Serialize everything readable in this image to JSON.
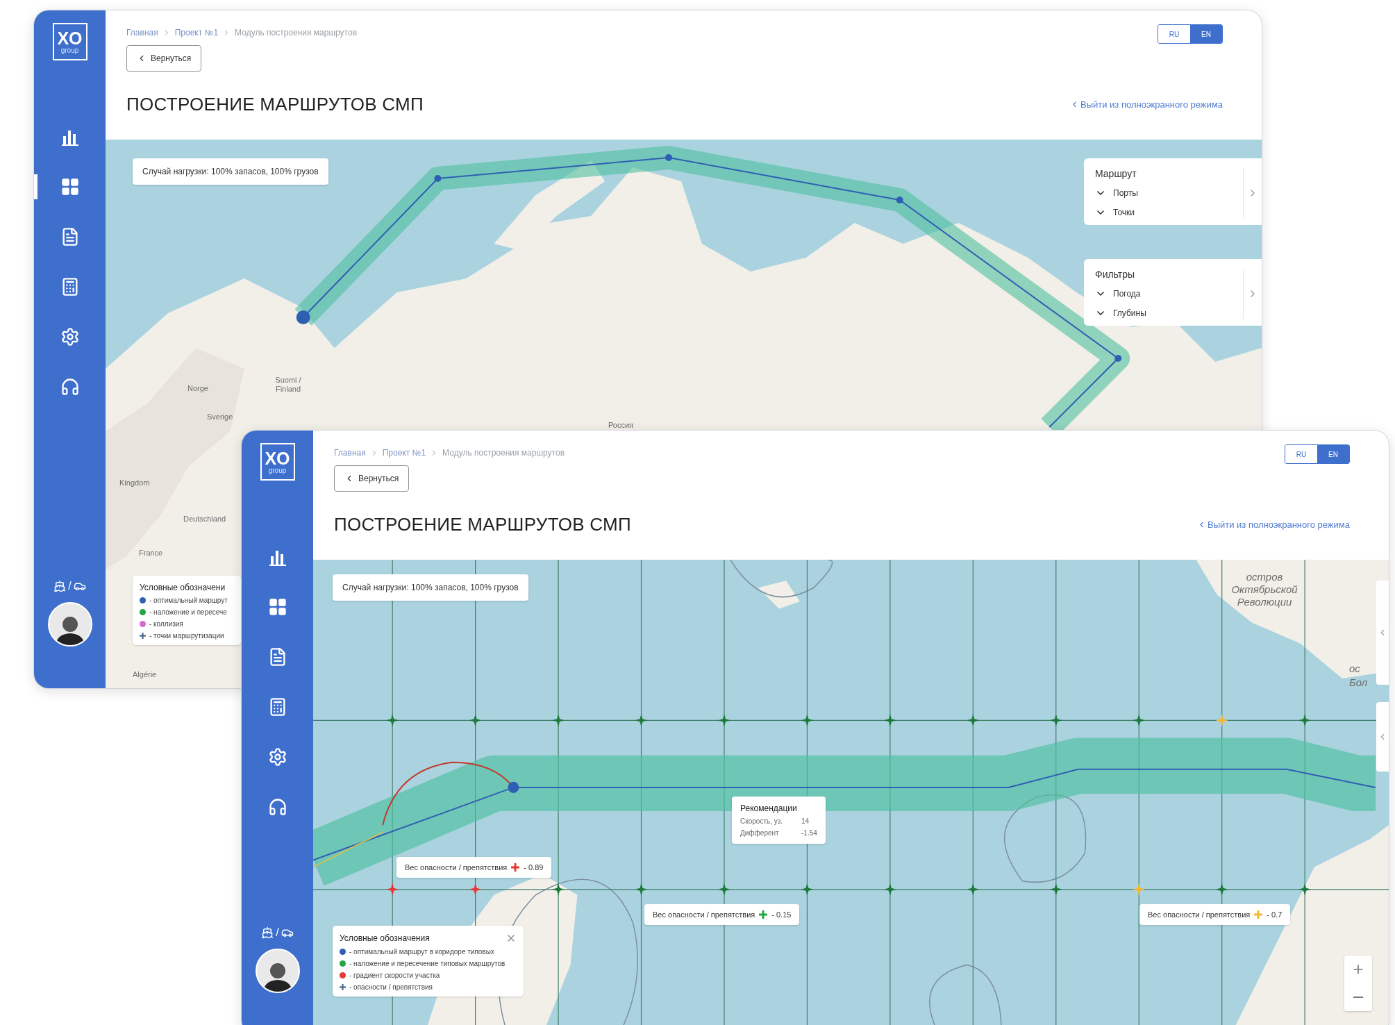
{
  "windows": [
    {
      "logo": {
        "main": "XO",
        "sub": "group"
      },
      "nav": [
        {
          "selected": false
        },
        {
          "selected": true
        },
        {
          "selected": false
        },
        {
          "selected": false
        },
        {
          "selected": false
        },
        {
          "selected": false
        }
      ],
      "transport_separator": "/",
      "breadcrumbs": [
        "Главная",
        "Проект №1",
        "Модуль построения маршрутов"
      ],
      "back_button": "Вернуться",
      "languages": [
        {
          "label": "RU",
          "selected": false
        },
        {
          "label": "EN",
          "selected": true
        }
      ],
      "title": "ПОСТРОЕНИЕ МАРШРУТОВ СМП",
      "exit_fullscreen": "Выйти из полноэкранного режима",
      "map": {
        "kind": "overview",
        "scenario": "Случай нагрузки: 100% запасов, 100% грузов",
        "labels": [
          "Norge",
          "Suomi / Finland",
          "Sverige",
          "Россия",
          "Kingdom",
          "Deutschland",
          "France",
          "Algérie"
        ],
        "panels": [
          {
            "title": "Маршрут",
            "items": [
              "Порты",
              "Точки"
            ]
          },
          {
            "title": "Фильтры",
            "items": [
              "Погода",
              "Глубины"
            ]
          }
        ],
        "legend": {
          "title": "Условные обозначени",
          "items": [
            {
              "kind": "dot",
              "color": "#2f5fb3",
              "text": "- оптимальный маршрут"
            },
            {
              "kind": "dot",
              "color": "#22a745",
              "text": "- наложение и пересече"
            },
            {
              "kind": "dot",
              "color": "#d66bd0",
              "text": "- коллизия"
            },
            {
              "kind": "cross",
              "color": "#4a6a8a",
              "text": "- точки маршрутизации"
            }
          ]
        }
      }
    },
    {
      "logo": {
        "main": "XO",
        "sub": "group"
      },
      "nav": [
        {
          "selected": false
        },
        {
          "selected": false
        },
        {
          "selected": false
        },
        {
          "selected": false
        },
        {
          "selected": false
        },
        {
          "selected": false
        }
      ],
      "transport_separator": "/",
      "breadcrumbs": [
        "Главная",
        "Проект №1",
        "Модуль построения маршрутов"
      ],
      "back_button": "Вернуться",
      "languages": [
        {
          "label": "RU",
          "selected": false
        },
        {
          "label": "EN",
          "selected": true
        }
      ],
      "title": "ПОСТРОЕНИЕ МАРШРУТОВ СМП",
      "exit_fullscreen": "Выйти из полноэкранного режима",
      "map": {
        "kind": "detail",
        "scenario": "Случай нагрузки: 100% запасов, 100% грузов",
        "labels": [
          "остров Октябрьской Революции",
          "ос",
          "Бол"
        ],
        "recommendation": {
          "title": "Рекомендации",
          "rows": [
            {
              "label": "Скорость, уз.",
              "value": "14"
            },
            {
              "label": "Дифферент",
              "value": "-1.54"
            }
          ]
        },
        "hazards": [
          {
            "label": "Вес опасности / препятствия",
            "color": "#e53935",
            "value": "- 0.89"
          },
          {
            "label": "Вес опасности / препятствия",
            "color": "#22a745",
            "value": "- 0.15"
          },
          {
            "label": "Вес опасности / препятствия",
            "color": "#f2b632",
            "value": "- 0.7"
          }
        ],
        "legend": {
          "title": "Условные обозначения",
          "items": [
            {
              "kind": "dot",
              "color": "#2f5fb3",
              "text": "- оптимальный маршрут в коридоре типовых"
            },
            {
              "kind": "dot",
              "color": "#22a745",
              "text": "- наложение и пересечение типовых маршрутов"
            },
            {
              "kind": "dot",
              "color": "#e53935",
              "text": "- градиент скорости участка"
            },
            {
              "kind": "cross",
              "color": "#4a6a8a",
              "text": "- опасности / препятствия"
            }
          ]
        }
      }
    }
  ]
}
